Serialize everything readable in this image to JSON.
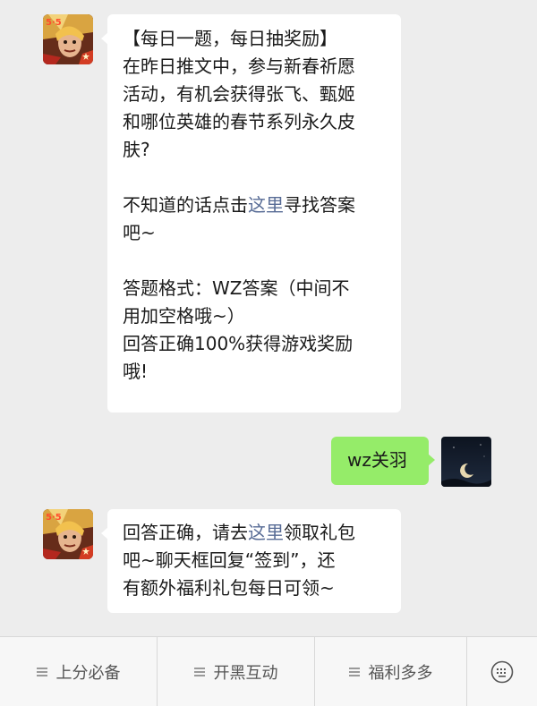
{
  "messages": [
    {
      "sender": "bot",
      "avatar_icon": "hero-portrait-icon",
      "lines": [
        "【每日一题，每日抽奖励】",
        "在昨日推文中，参与新春祈愿",
        "活动，有机会获得张飞、甄姬",
        "和哪位英雄的春节系列永久皮",
        "肤?",
        "",
        "不知道的话点击|这里|寻找答案",
        "吧~",
        "",
        "答题格式：WZ答案（中间不",
        "用加空格哦~）",
        "回答正确100%获得游戏奖励",
        "哦!"
      ],
      "link_prefix": "不知道的话点击",
      "link_text": "这里",
      "link_suffix": "寻找答案"
    },
    {
      "sender": "user",
      "avatar_icon": "crescent-moon-icon",
      "text": "wz关羽"
    },
    {
      "sender": "bot",
      "avatar_icon": "hero-portrait-icon",
      "line1_prefix": "回答正确，请去",
      "link_text": "这里",
      "line1_suffix": "领取礼包",
      "line2": "吧~聊天框回复“签到”，还",
      "line3": "有额外福利礼包每日可领~"
    }
  ],
  "menu": {
    "items": [
      {
        "label": "上分必备",
        "icon": "menu-lines-icon"
      },
      {
        "label": "开黑互动",
        "icon": "menu-lines-icon"
      },
      {
        "label": "福利多多",
        "icon": "menu-lines-icon"
      }
    ],
    "keyboard_icon": "keyboard-toggle-icon"
  },
  "colors": {
    "background": "#ededed",
    "bot_bubble": "#ffffff",
    "user_bubble": "#95ec69",
    "link": "#576b95",
    "menubar": "#f7f7f7"
  }
}
